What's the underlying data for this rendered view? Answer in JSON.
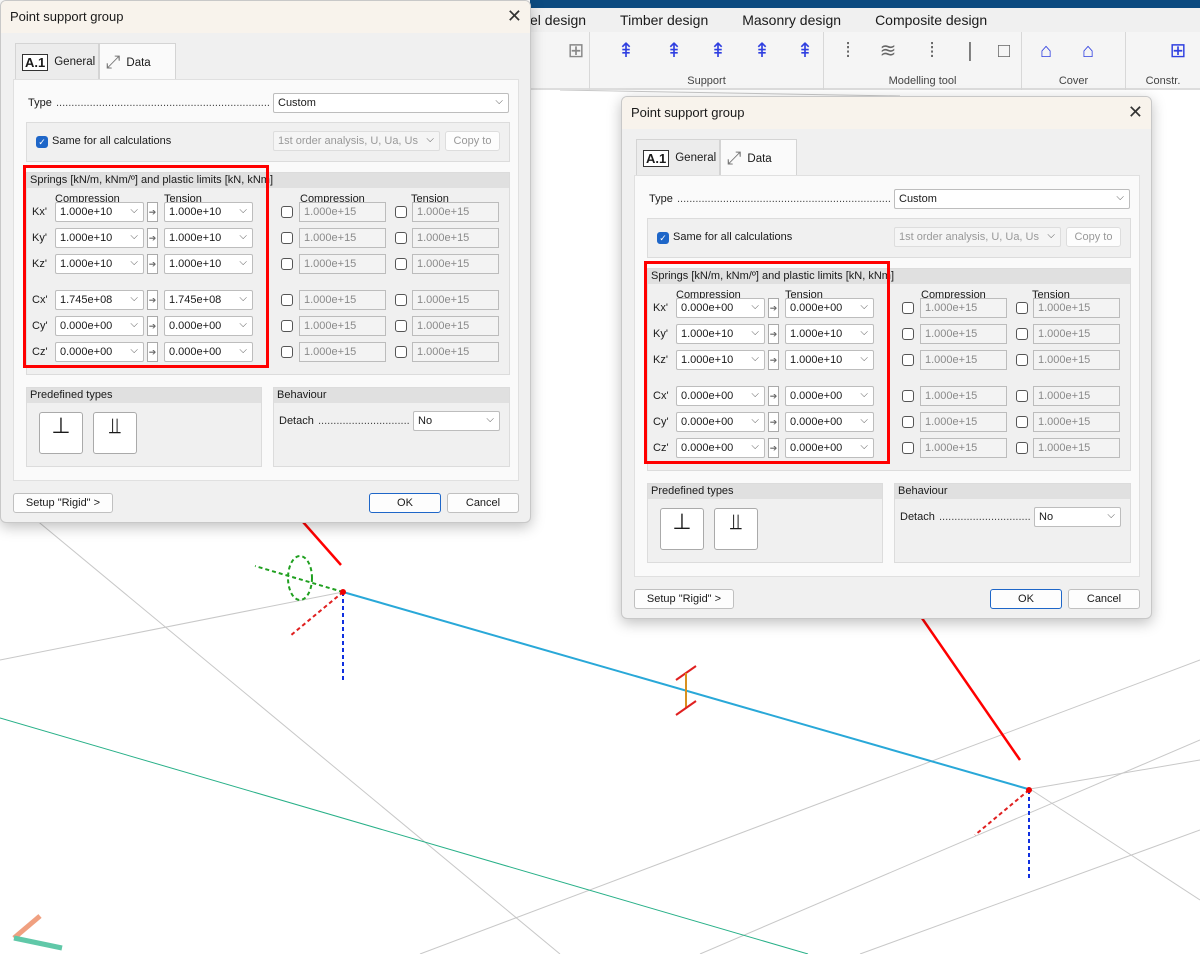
{
  "app": {
    "menu_tabs": [
      "el design",
      "Timber design",
      "Masonry design",
      "Composite design"
    ],
    "ribbon_groups": [
      {
        "label": "Support"
      },
      {
        "label": "Modelling tool"
      },
      {
        "label": "Cover"
      },
      {
        "label": "Constr."
      }
    ],
    "colors": {
      "title_bar": "#0b4a80",
      "beam": "#29a8d8",
      "annotation": "#ff0000",
      "accent": "#1e66c8"
    }
  },
  "dialogs": [
    {
      "title": "Point support group",
      "tabs": [
        {
          "badge": "A.1",
          "label": "General"
        },
        {
          "label": "Data",
          "active": true
        }
      ],
      "type_label": "Type",
      "type_value": "Custom",
      "same_label": "Same for all calculations",
      "same_checked": true,
      "calc_value": "1st order analysis, U, Ua, Us",
      "copy_to": "Copy to",
      "springs_header": "Springs [kN/m, kNm/º] and plastic limits [kN, kNm]",
      "col_compression": "Compression",
      "col_tension": "Tension",
      "rows": [
        {
          "label": "Kx'",
          "comp": "1.000e+10",
          "tens": "1.000e+10",
          "plim_comp": "1.000e+15",
          "plim_tens": "1.000e+15"
        },
        {
          "label": "Ky'",
          "comp": "1.000e+10",
          "tens": "1.000e+10",
          "plim_comp": "1.000e+15",
          "plim_tens": "1.000e+15"
        },
        {
          "label": "Kz'",
          "comp": "1.000e+10",
          "tens": "1.000e+10",
          "plim_comp": "1.000e+15",
          "plim_tens": "1.000e+15"
        },
        {
          "label": "Cx'",
          "comp": "1.745e+08",
          "tens": "1.745e+08",
          "plim_comp": "1.000e+15",
          "plim_tens": "1.000e+15"
        },
        {
          "label": "Cy'",
          "comp": "0.000e+00",
          "tens": "0.000e+00",
          "plim_comp": "1.000e+15",
          "plim_tens": "1.000e+15"
        },
        {
          "label": "Cz'",
          "comp": "0.000e+00",
          "tens": "0.000e+00",
          "plim_comp": "1.000e+15",
          "plim_tens": "1.000e+15"
        }
      ],
      "predefined_label": "Predefined types",
      "behaviour_label": "Behaviour",
      "detach_label": "Detach",
      "detach_value": "No",
      "setup_rigid": "Setup \"Rigid\" >",
      "ok": "OK",
      "cancel": "Cancel"
    },
    {
      "title": "Point support group",
      "tabs": [
        {
          "badge": "A.1",
          "label": "General"
        },
        {
          "label": "Data",
          "active": true
        }
      ],
      "type_label": "Type",
      "type_value": "Custom",
      "same_label": "Same for all calculations",
      "same_checked": true,
      "calc_value": "1st order analysis, U, Ua, Us",
      "copy_to": "Copy to",
      "springs_header": "Springs [kN/m, kNm/º] and plastic limits [kN, kNm]",
      "col_compression": "Compression",
      "col_tension": "Tension",
      "rows": [
        {
          "label": "Kx'",
          "comp": "0.000e+00",
          "tens": "0.000e+00",
          "plim_comp": "1.000e+15",
          "plim_tens": "1.000e+15"
        },
        {
          "label": "Ky'",
          "comp": "1.000e+10",
          "tens": "1.000e+10",
          "plim_comp": "1.000e+15",
          "plim_tens": "1.000e+15"
        },
        {
          "label": "Kz'",
          "comp": "1.000e+10",
          "tens": "1.000e+10",
          "plim_comp": "1.000e+15",
          "plim_tens": "1.000e+15"
        },
        {
          "label": "Cx'",
          "comp": "0.000e+00",
          "tens": "0.000e+00",
          "plim_comp": "1.000e+15",
          "plim_tens": "1.000e+15"
        },
        {
          "label": "Cy'",
          "comp": "0.000e+00",
          "tens": "0.000e+00",
          "plim_comp": "1.000e+15",
          "plim_tens": "1.000e+15"
        },
        {
          "label": "Cz'",
          "comp": "0.000e+00",
          "tens": "0.000e+00",
          "plim_comp": "1.000e+15",
          "plim_tens": "1.000e+15"
        }
      ],
      "predefined_label": "Predefined types",
      "behaviour_label": "Behaviour",
      "detach_label": "Detach",
      "detach_value": "No",
      "setup_rigid": "Setup \"Rigid\" >",
      "ok": "OK",
      "cancel": "Cancel"
    }
  ]
}
